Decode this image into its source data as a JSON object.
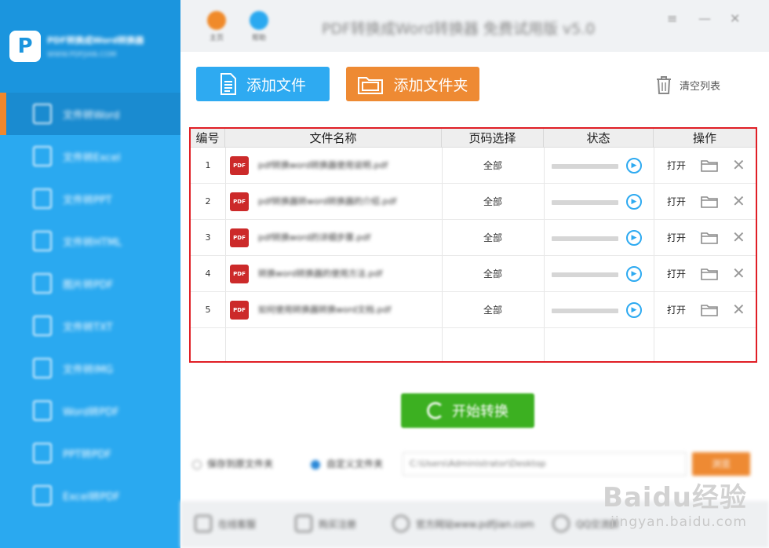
{
  "window": {
    "title": "PDF转换成Word转换器 免费试用版 v5.0",
    "minimize_glyph": "—",
    "close_glyph": "✕",
    "header_buttons": [
      {
        "label": "主页",
        "color": "#f08a2a"
      },
      {
        "label": "帮助",
        "color": "#2aa9f0"
      }
    ]
  },
  "sidebar": {
    "brand_name": "PDF转换成Word转换器",
    "brand_sub": "WWW.PDFJIAN.COM",
    "items": [
      {
        "label": "文件转Word",
        "active": true
      },
      {
        "label": "文件转Excel",
        "active": false
      },
      {
        "label": "文件转PPT",
        "active": false
      },
      {
        "label": "文件转HTML",
        "active": false
      },
      {
        "label": "图片转PDF",
        "active": false
      },
      {
        "label": "文件转TXT",
        "active": false
      },
      {
        "label": "文件转IMG",
        "active": false
      },
      {
        "label": "Word转PDF",
        "active": false
      },
      {
        "label": "PPT转PDF",
        "active": false
      },
      {
        "label": "Excel转PDF",
        "active": false
      }
    ]
  },
  "toolbar": {
    "add_file_label": "添加文件",
    "add_folder_label": "添加文件夹",
    "clear_label": "清空列表"
  },
  "table": {
    "columns": [
      "编号",
      "文件名称",
      "页码选择",
      "状态",
      "操作"
    ],
    "rows": [
      {
        "num": "1",
        "icon_text": "PDF",
        "filename": "pdf转换word转换器使用说明.pdf",
        "pages": "全部",
        "progress": 0,
        "open_label": "打开"
      },
      {
        "num": "2",
        "icon_text": "PDF",
        "filename": "pdf转换器转word转换器的介绍.pdf",
        "pages": "全部",
        "progress": 0,
        "open_label": "打开"
      },
      {
        "num": "3",
        "icon_text": "PDF",
        "filename": "pdf转换word的详细步骤.pdf",
        "pages": "全部",
        "progress": 0,
        "open_label": "打开"
      },
      {
        "num": "4",
        "icon_text": "PDF",
        "filename": "转换word转换器的使用方法.pdf",
        "pages": "全部",
        "progress": 0,
        "open_label": "打开"
      },
      {
        "num": "5",
        "icon_text": "PDF",
        "filename": "如何使用转换器转换word文档.pdf",
        "pages": "全部",
        "progress": 0,
        "open_label": "打开"
      }
    ]
  },
  "actions": {
    "convert_label": "开始转换"
  },
  "output": {
    "option_original": "保存到原文件夹",
    "option_custom": "自定义文件夹",
    "selected": "custom",
    "path_value": "C:\\Users\\Administrator\\Desktop",
    "browse_label": "浏览"
  },
  "footer": {
    "items": [
      "在线客服",
      "购买注册",
      "官方网站www.pdfjian.com",
      "QQ交流群"
    ]
  },
  "watermark": {
    "logo": "Baidu经验",
    "site": "jingyan.baidu.com"
  }
}
